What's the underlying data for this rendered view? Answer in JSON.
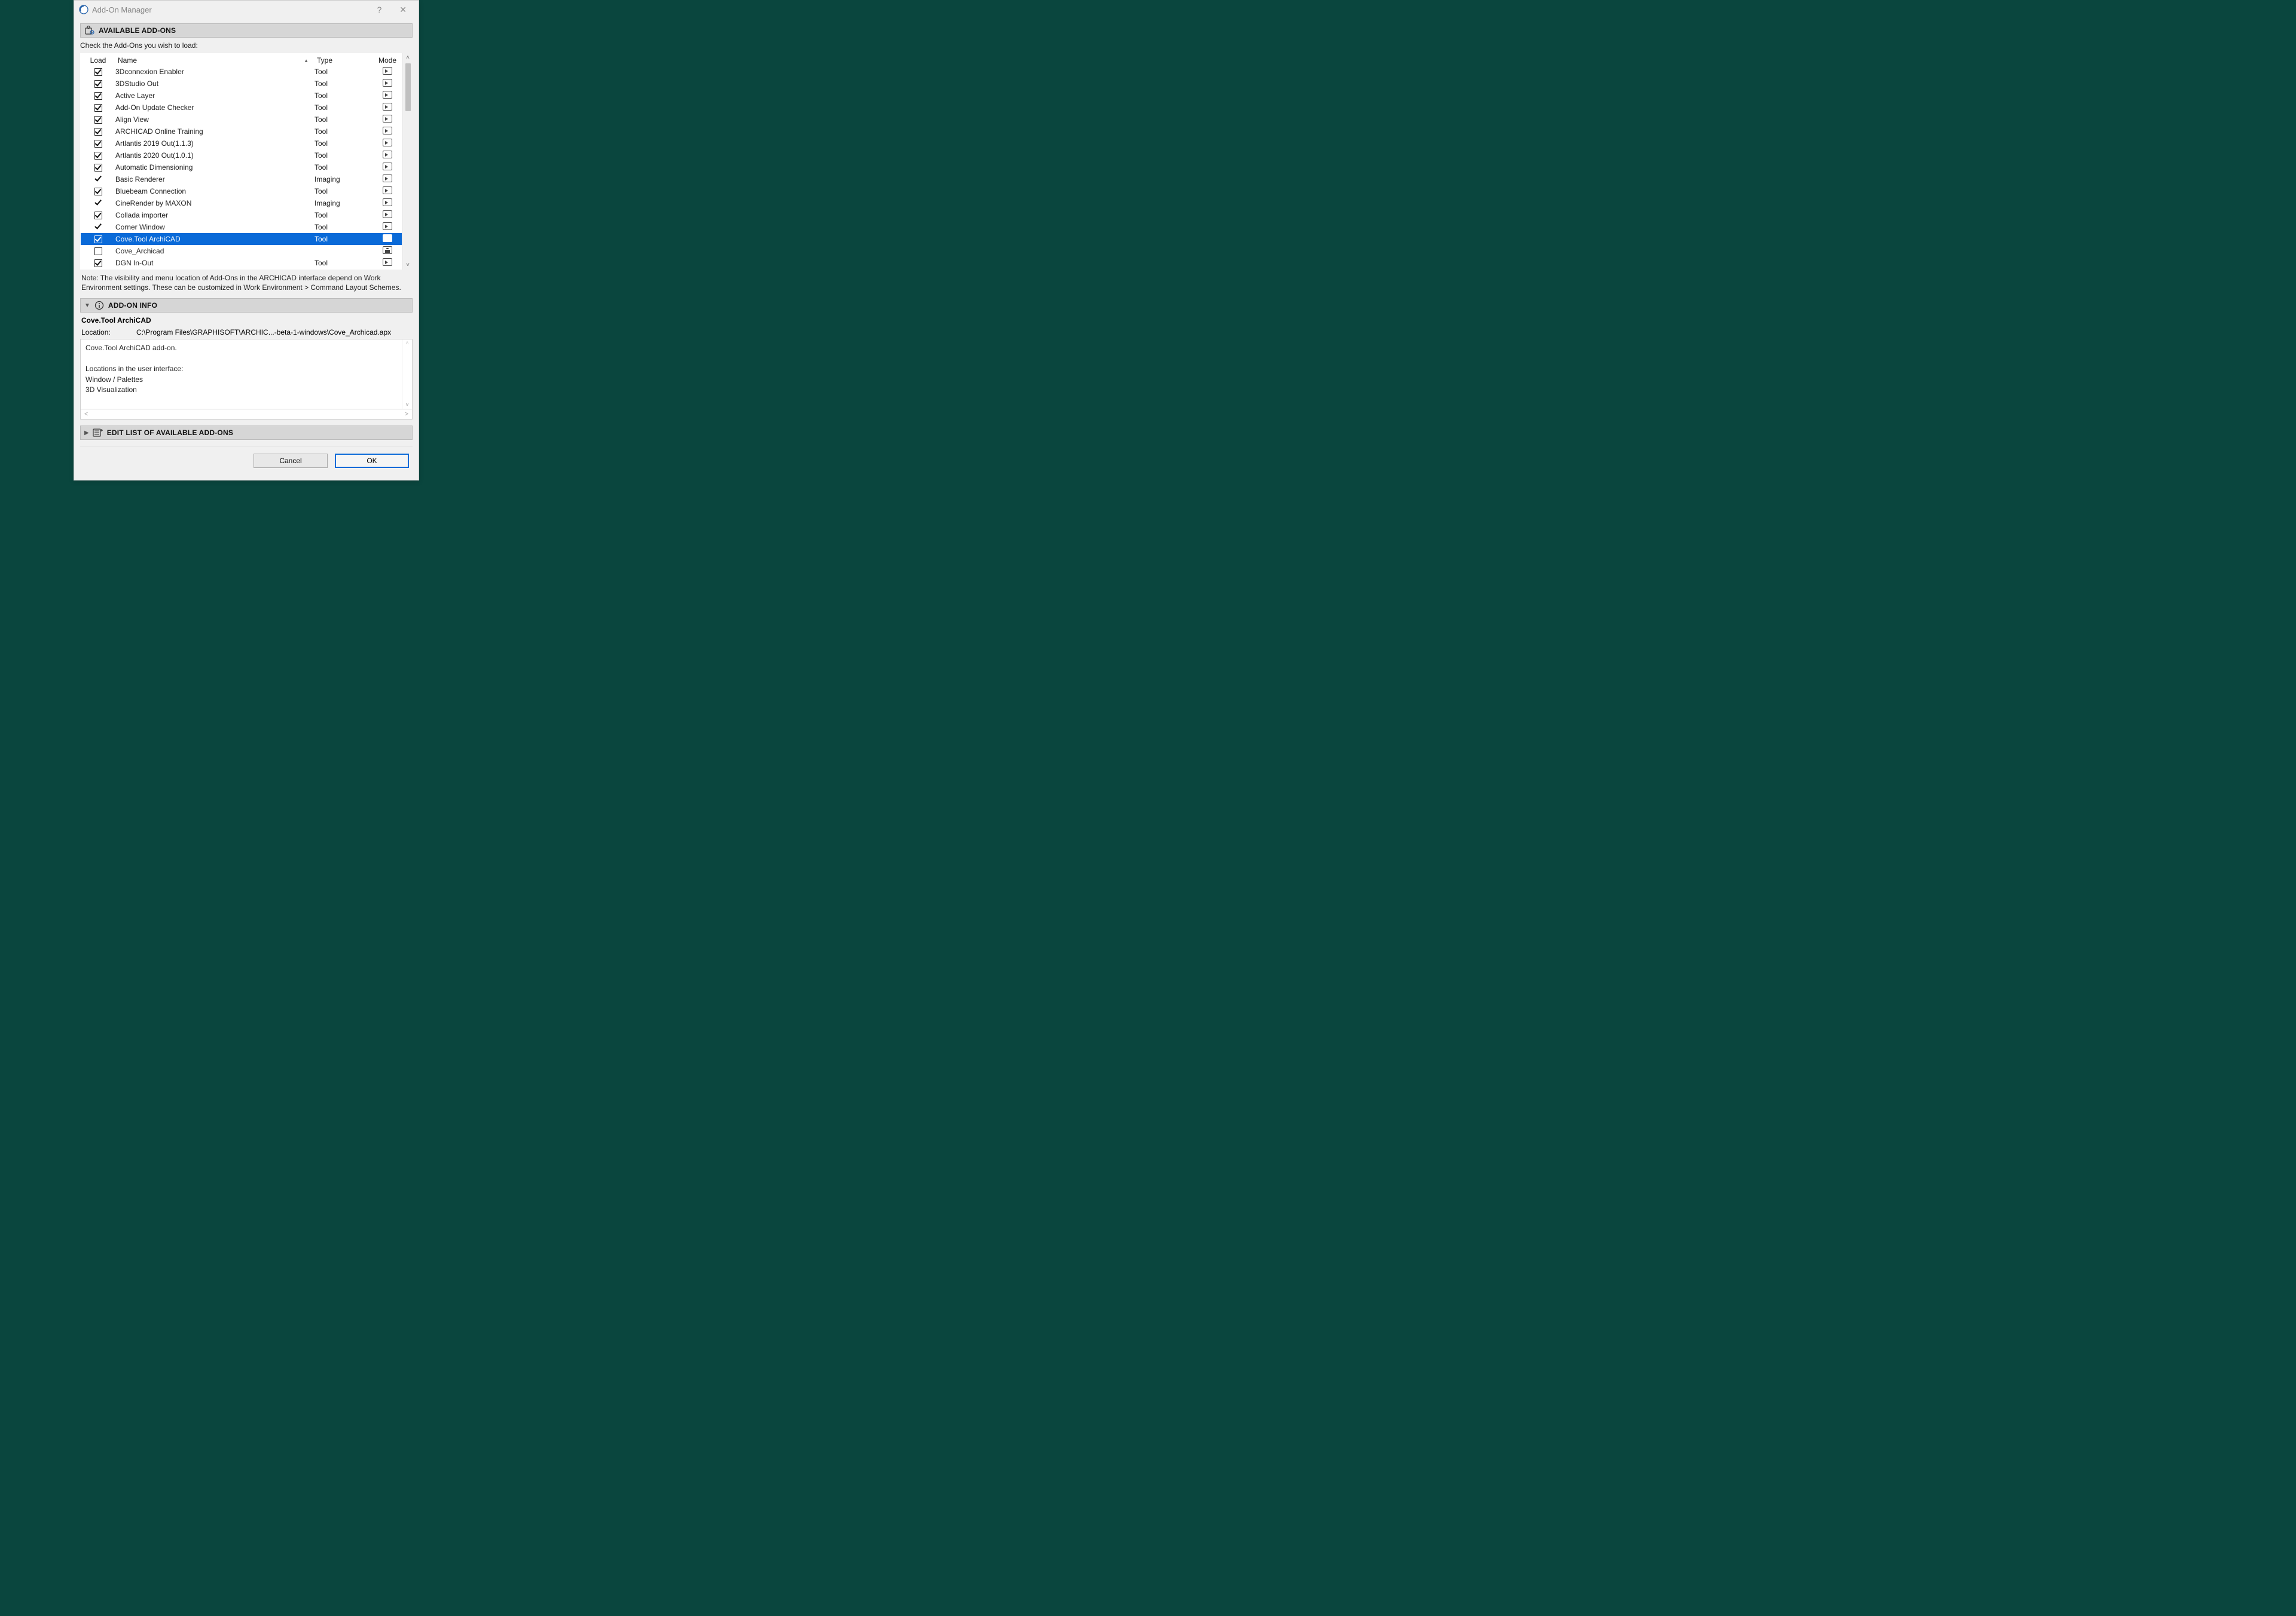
{
  "window": {
    "title": "Add-On Manager"
  },
  "sections": {
    "available": {
      "title": "AVAILABLE ADD-ONS"
    },
    "info": {
      "title": "ADD-ON INFO"
    },
    "edit": {
      "title": "EDIT LIST OF AVAILABLE ADD-ONS"
    }
  },
  "instruction": "Check the Add-Ons you wish to load:",
  "columns": {
    "load": "Load",
    "name": "Name",
    "type": "Type",
    "mode": "Mode"
  },
  "addons": [
    {
      "name": "3Dconnexion Enabler",
      "type": "Tool",
      "check": "box-checked",
      "mode": "doc",
      "selected": false
    },
    {
      "name": "3DStudio Out",
      "type": "Tool",
      "check": "box-checked",
      "mode": "doc",
      "selected": false
    },
    {
      "name": "Active Layer",
      "type": "Tool",
      "check": "box-checked",
      "mode": "doc",
      "selected": false
    },
    {
      "name": "Add-On Update Checker",
      "type": "Tool",
      "check": "box-checked",
      "mode": "doc",
      "selected": false
    },
    {
      "name": "Align View",
      "type": "Tool",
      "check": "box-checked",
      "mode": "doc",
      "selected": false
    },
    {
      "name": "ARCHICAD Online Training",
      "type": "Tool",
      "check": "box-checked",
      "mode": "doc",
      "selected": false
    },
    {
      "name": "Artlantis 2019 Out(1.1.3)",
      "type": "Tool",
      "check": "box-checked",
      "mode": "doc",
      "selected": false
    },
    {
      "name": "Artlantis 2020 Out(1.0.1)",
      "type": "Tool",
      "check": "box-checked",
      "mode": "doc",
      "selected": false
    },
    {
      "name": "Automatic Dimensioning",
      "type": "Tool",
      "check": "box-checked",
      "mode": "doc",
      "selected": false
    },
    {
      "name": "Basic Renderer",
      "type": "Imaging",
      "check": "mark",
      "mode": "doc",
      "selected": false
    },
    {
      "name": "Bluebeam Connection",
      "type": "Tool",
      "check": "box-checked",
      "mode": "doc",
      "selected": false
    },
    {
      "name": "CineRender by MAXON",
      "type": "Imaging",
      "check": "mark",
      "mode": "doc",
      "selected": false
    },
    {
      "name": "Collada importer",
      "type": "Tool",
      "check": "box-checked",
      "mode": "doc",
      "selected": false
    },
    {
      "name": "Corner Window",
      "type": "Tool",
      "check": "mark",
      "mode": "doc",
      "selected": false
    },
    {
      "name": "Cove.Tool ArchiCAD",
      "type": "Tool",
      "check": "box-checked",
      "mode": "doc",
      "selected": true
    },
    {
      "name": "Cove_Archicad",
      "type": "",
      "check": "box-empty",
      "mode": "puzzle",
      "selected": false
    },
    {
      "name": "DGN In-Out",
      "type": "Tool",
      "check": "box-checked",
      "mode": "doc",
      "selected": false
    }
  ],
  "note": "Note: The visibility and menu location of Add-Ons in the ARCHICAD interface depend on Work Environment settings. These can be customized in Work Environment > Command Layout Schemes.",
  "info": {
    "name": "Cove.Tool ArchiCAD",
    "location_label": "Location:",
    "location_value": "C:\\Program Files\\GRAPHISOFT\\ARCHIC...-beta-1-windows\\Cove_Archicad.apx",
    "desc_line1": "Cove.Tool ArchiCAD add-on.",
    "desc_line2": "Locations in the user interface:",
    "desc_line3": "Window / Palettes",
    "desc_line4": "3D Visualization"
  },
  "buttons": {
    "cancel": "Cancel",
    "ok": "OK"
  }
}
